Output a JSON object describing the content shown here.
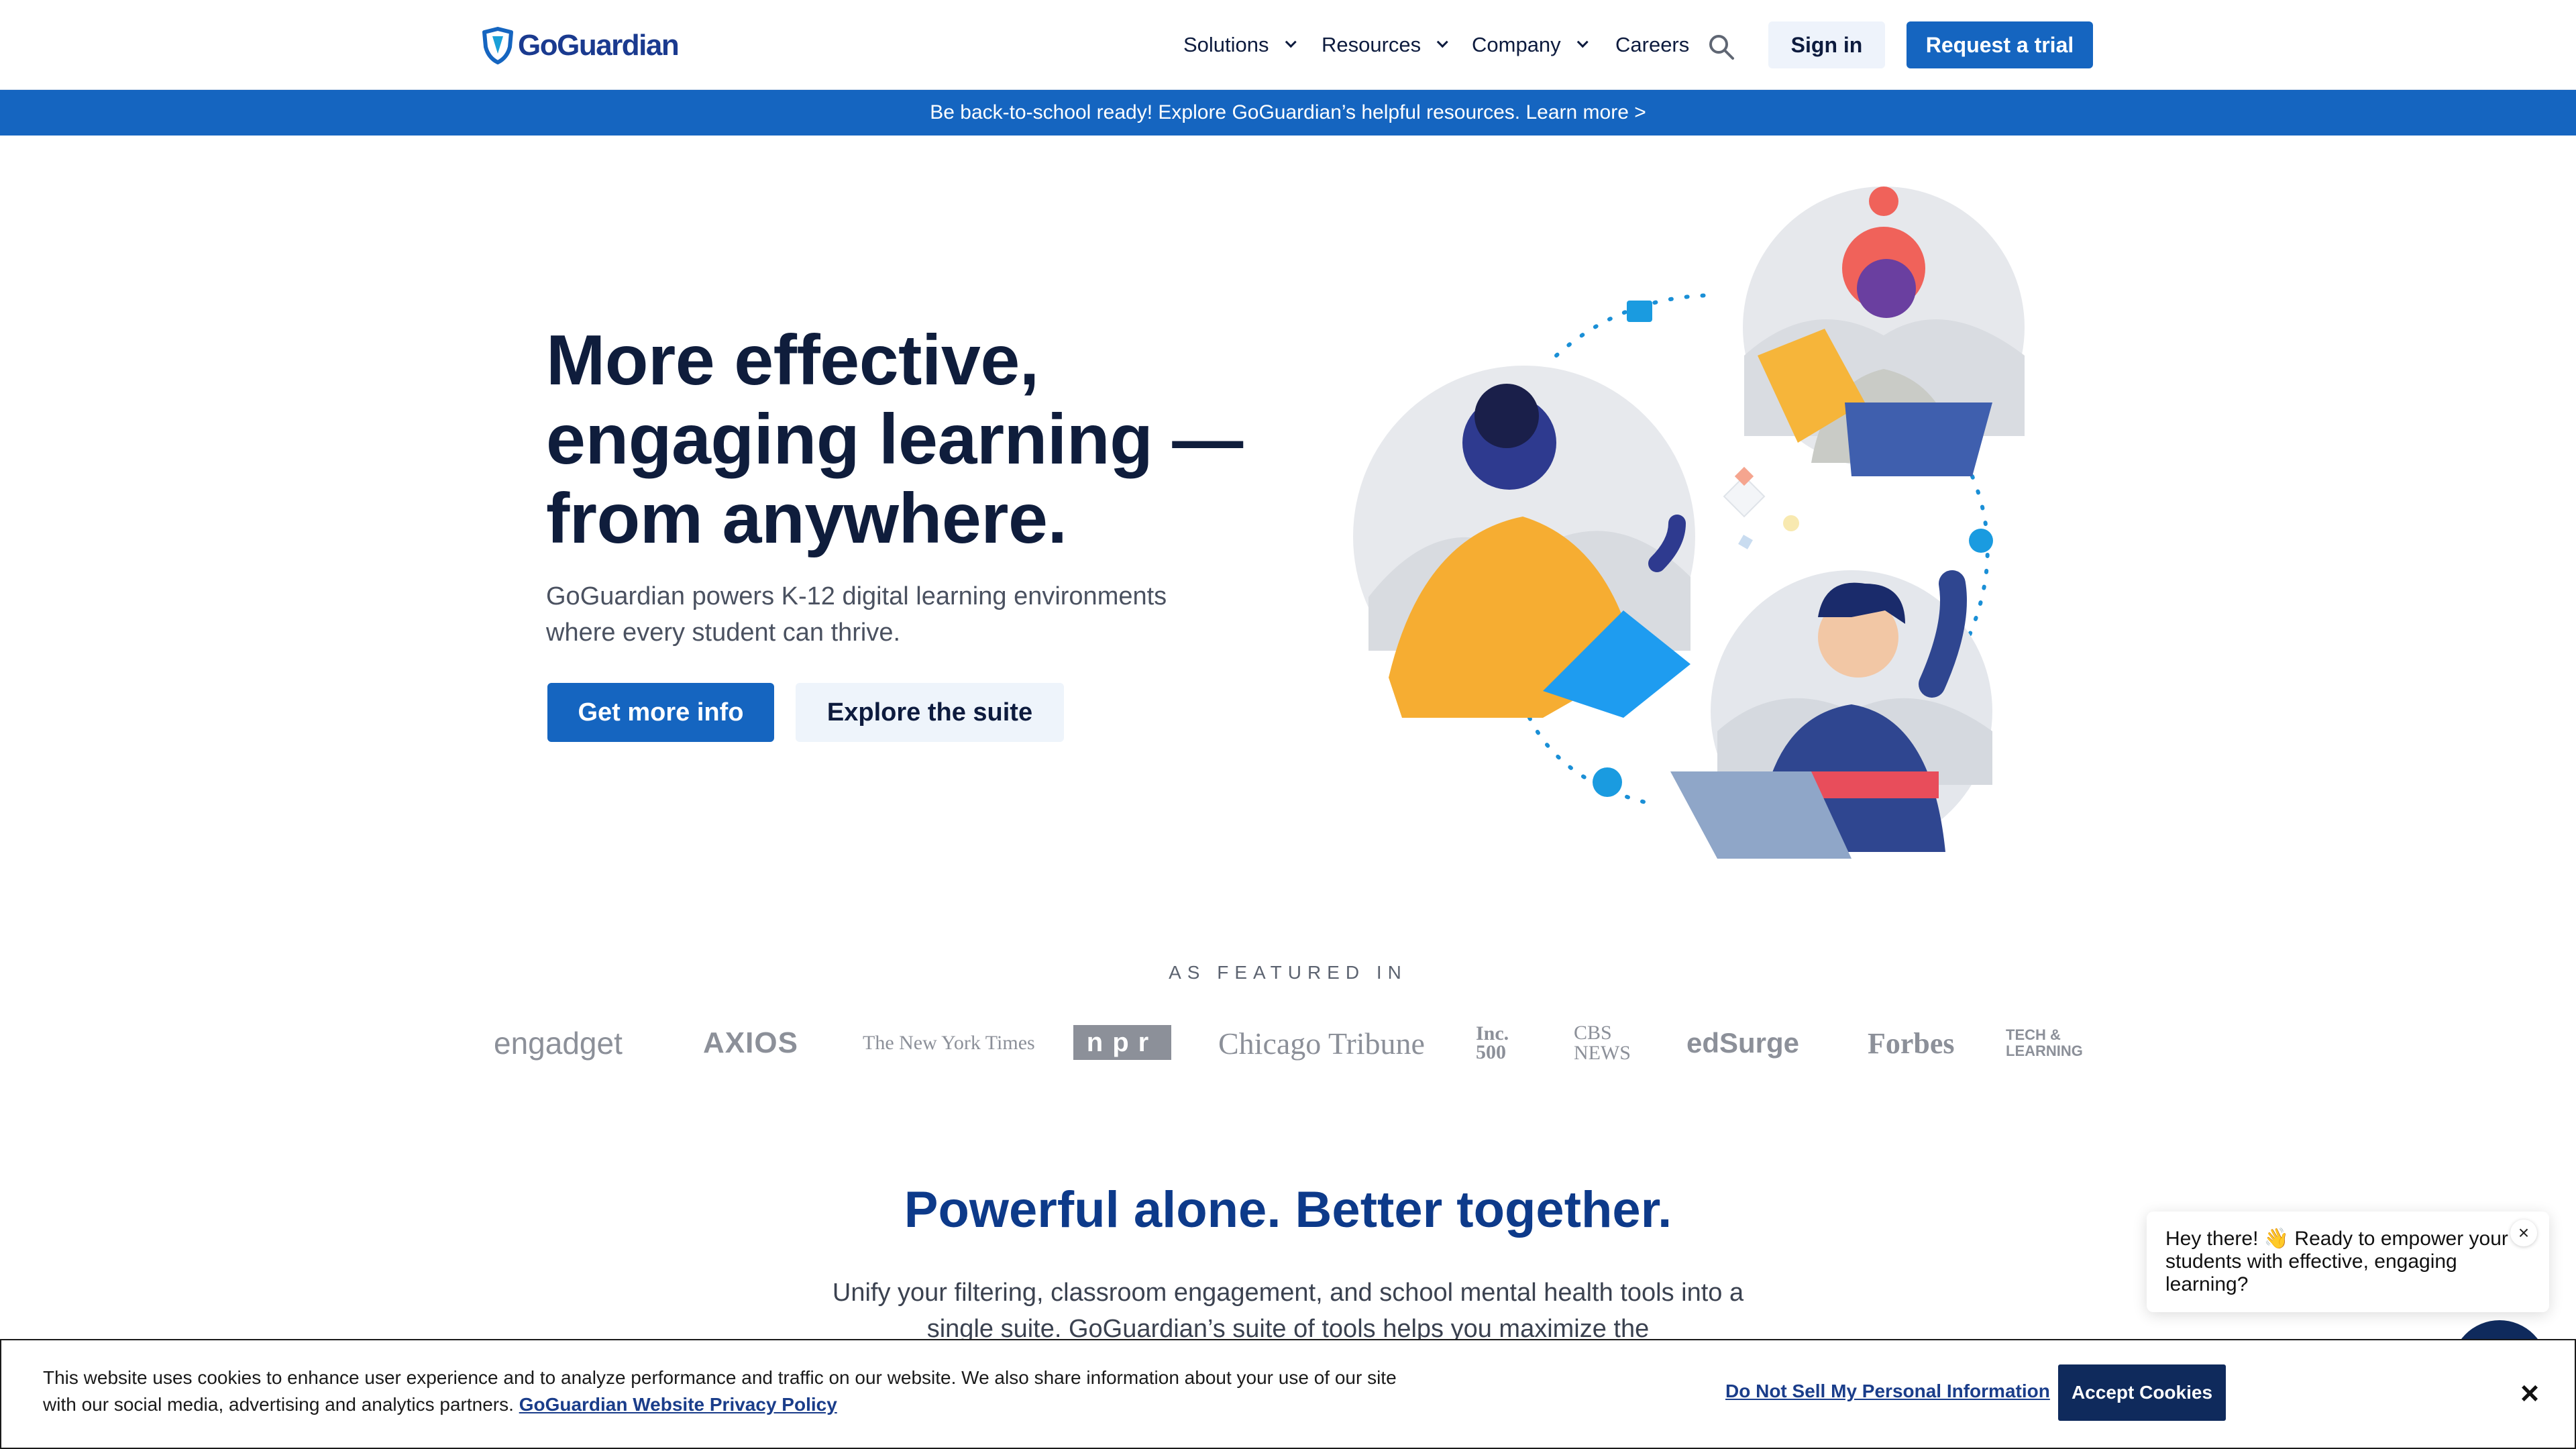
{
  "header": {
    "brand": "GoGuardian",
    "nav": [
      {
        "label": "Solutions",
        "has_dropdown": true
      },
      {
        "label": "Resources",
        "has_dropdown": true
      },
      {
        "label": "Company",
        "has_dropdown": true
      },
      {
        "label": "Careers",
        "has_dropdown": false
      }
    ],
    "sign_in": "Sign in",
    "request_trial": "Request a trial"
  },
  "banner": {
    "text": "Be back-to-school ready! Explore GoGuardian’s helpful resources. Learn more >"
  },
  "hero": {
    "title_lines": [
      "More effective,",
      "engaging learning —",
      "from anywhere."
    ],
    "subtitle": "GoGuardian powers K-12 digital learning environments where every student can thrive.",
    "primary_cta": "Get more info",
    "secondary_cta": "Explore the suite"
  },
  "featured": {
    "label": "AS FEATURED IN",
    "logos": [
      "engadget",
      "AXIOS",
      "The New York Times",
      "npr",
      "Chicago Tribune",
      "Inc. 500",
      "CBS NEWS",
      "edSurge",
      "Forbes",
      "TECH & LEARNING"
    ]
  },
  "section": {
    "title": "Powerful alone. Better together.",
    "text": "Unify your filtering, classroom engagement, and school mental health tools into a single suite. GoGuardian’s suite of tools helps you maximize the"
  },
  "chat": {
    "message": "Hey there! 👋 Ready to empower your students with effective, engaging learning?",
    "close": "×"
  },
  "cookie": {
    "text": "This website uses cookies to enhance user experience and to analyze performance and traffic on our website. We also share information about your use of our site with our social media, advertising and analytics partners.",
    "policy_link": "GoGuardian Website Privacy Policy",
    "do_not_sell": "Do Not Sell My Personal Information",
    "accept": "Accept Cookies",
    "close": "×"
  },
  "colors": {
    "primary": "#1565c0",
    "navy": "#0f2a5c",
    "heading": "#0d3a8a",
    "text": "#0f1d3c"
  }
}
